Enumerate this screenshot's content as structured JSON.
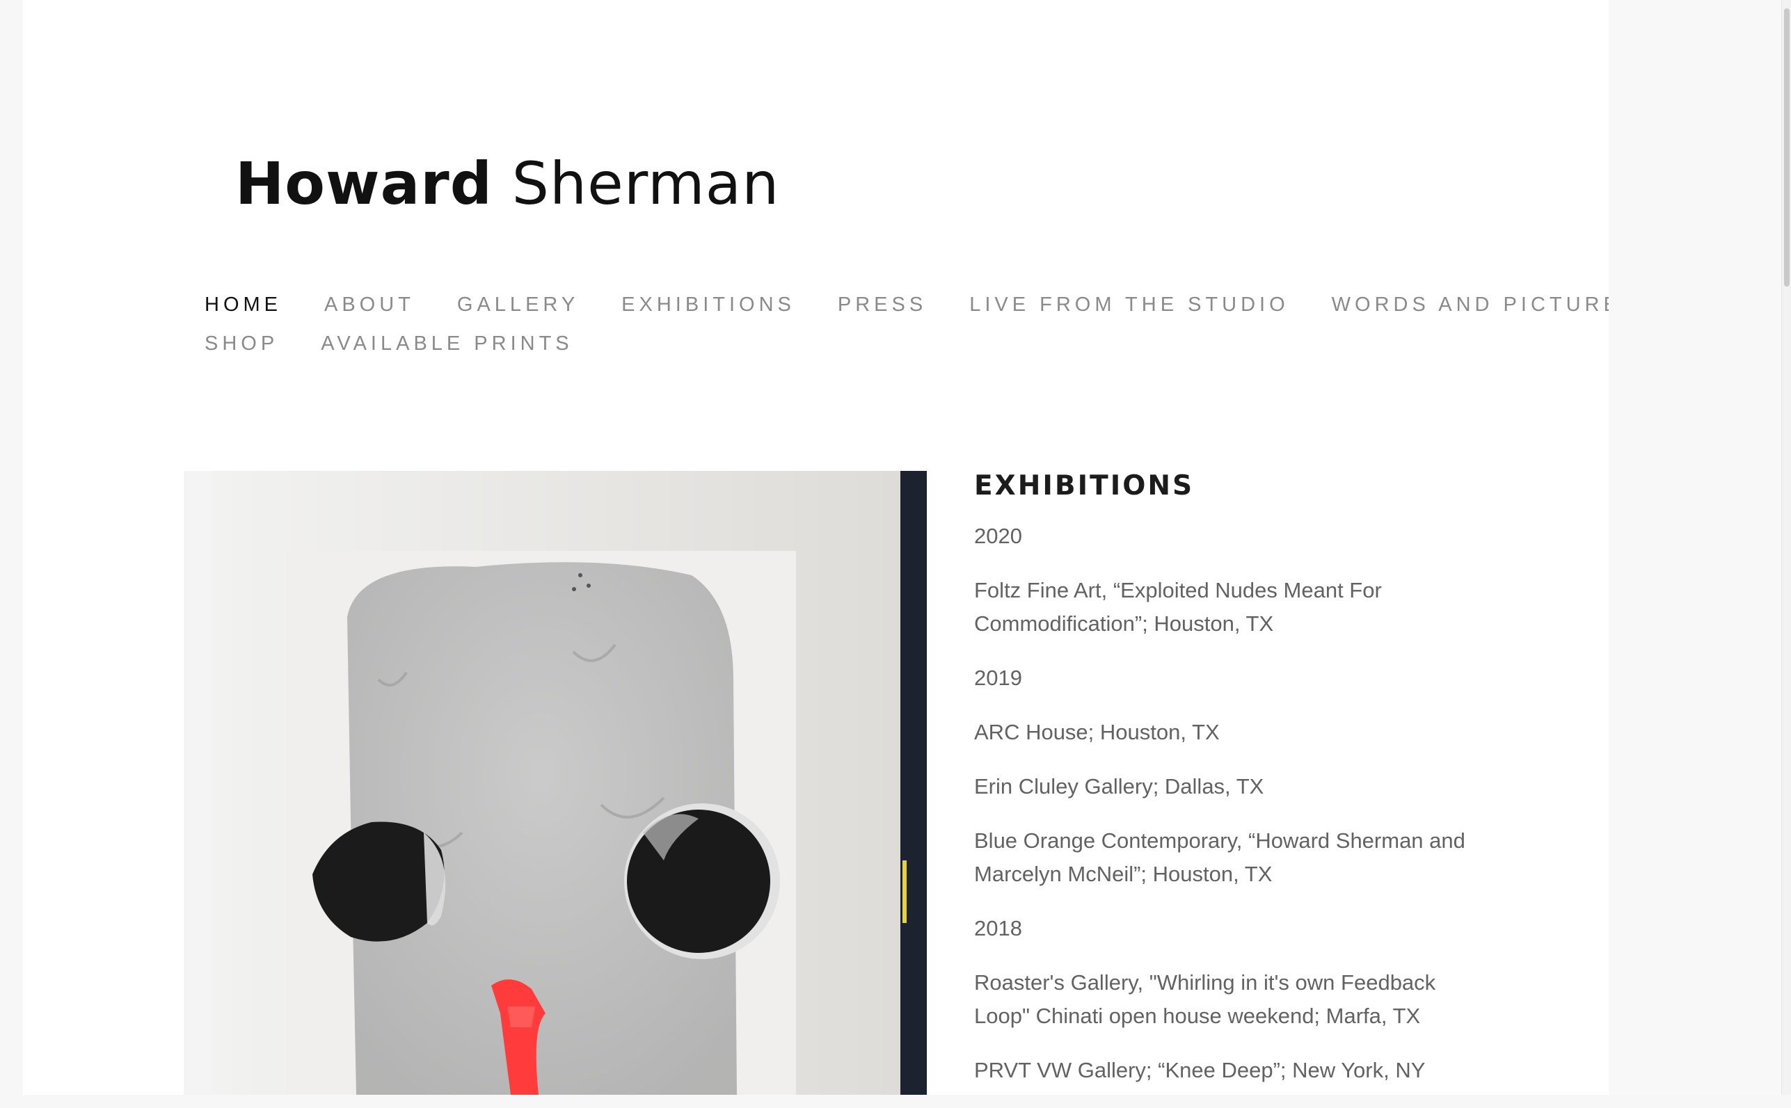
{
  "site": {
    "logo_first": "Howard",
    "logo_last": "Sherman"
  },
  "nav": {
    "row1": [
      {
        "label": "HOME",
        "active": true
      },
      {
        "label": "ABOUT",
        "active": false
      },
      {
        "label": "GALLERY",
        "active": false
      },
      {
        "label": "EXHIBITIONS",
        "active": false
      },
      {
        "label": "PRESS",
        "active": false
      },
      {
        "label": "LIVE FROM THE STUDIO",
        "active": false
      },
      {
        "label": "WORDS AND PICTURES",
        "active": false
      }
    ],
    "row2": [
      {
        "label": "SHOP",
        "active": false
      },
      {
        "label": "AVAILABLE PRINTS",
        "active": false
      }
    ]
  },
  "artwork": {
    "description_icon": "painting-image"
  },
  "exhibitions": {
    "heading": "EXHIBITIONS",
    "entries": [
      "2020",
      "Foltz Fine Art, “Exploited Nudes Meant For Commodification”; Houston, TX",
      "2019",
      "ARC House; Houston, TX",
      "Erin Cluley Gallery; Dallas, TX",
      "Blue Orange Contemporary, “Howard Sherman and Marcelyn McNeil”; Houston, TX",
      "2018",
      "Roaster's Gallery, \"Whirling in it's own Feedback Loop\" Chinati open house weekend; Marfa, TX",
      "PRVT VW Gallery; “Knee Deep”; New York, NY"
    ]
  },
  "colors": {
    "accent_red": "#ff3b3b",
    "text_dark": "#1c1c1c",
    "nav_inactive": "#8a8a8a"
  }
}
